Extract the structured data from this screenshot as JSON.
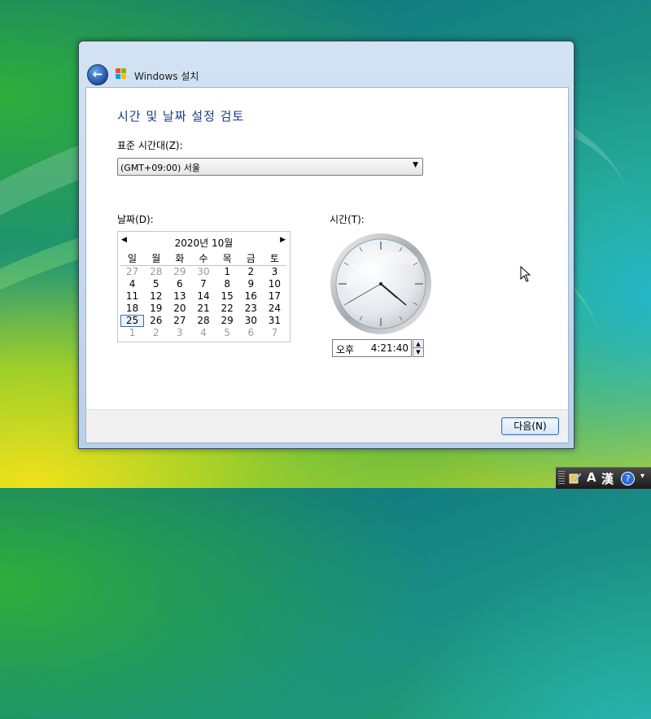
{
  "window": {
    "title": "Windows 설치"
  },
  "page": {
    "heading": "시간 및 날짜 설정 검토",
    "timezone_label": "표준 시간대(Z):",
    "timezone_value": "(GMT+09:00) 서울",
    "date_label": "날짜(D):",
    "time_label": "시간(T):"
  },
  "calendar": {
    "month_title": "2020년 10월",
    "weekdays": [
      "일",
      "월",
      "화",
      "수",
      "목",
      "금",
      "토"
    ],
    "weeks": [
      [
        "27",
        "28",
        "29",
        "30",
        "1",
        "2",
        "3"
      ],
      [
        "4",
        "5",
        "6",
        "7",
        "8",
        "9",
        "10"
      ],
      [
        "11",
        "12",
        "13",
        "14",
        "15",
        "16",
        "17"
      ],
      [
        "18",
        "19",
        "20",
        "21",
        "22",
        "23",
        "24"
      ],
      [
        "25",
        "26",
        "27",
        "28",
        "29",
        "30",
        "31"
      ],
      [
        "1",
        "2",
        "3",
        "4",
        "5",
        "6",
        "7"
      ]
    ],
    "selected_day": "25"
  },
  "clock": {
    "hour": 4,
    "minute": 21,
    "second": 40
  },
  "time": {
    "ampm": "오후",
    "value": "4:21:40"
  },
  "buttons": {
    "next": "다음(N)"
  },
  "icons": {
    "back": "back-arrow-icon",
    "windows_logo": "windows-logo-icon",
    "dropdown": "dropdown-arrow-icon"
  },
  "langbar": {
    "ime_mode": "A",
    "hanja": "漢",
    "help": "?"
  }
}
